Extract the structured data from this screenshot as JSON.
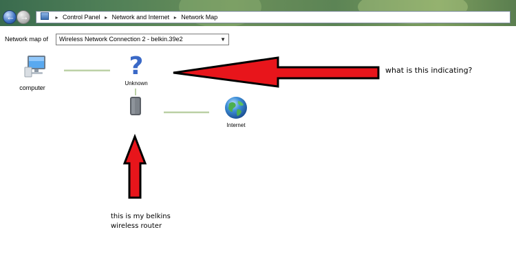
{
  "address_bar": {
    "crumbs": [
      "Control Panel",
      "Network and Internet",
      "Network Map"
    ],
    "back_icon": "back-arrow-icon",
    "forward_icon": "forward-arrow-icon"
  },
  "map_selector": {
    "label": "Network map of",
    "selected": "Wireless Network Connection 2 - belkin.39e2"
  },
  "nodes": {
    "computer": {
      "label": "computer",
      "icon": "computer-icon"
    },
    "unknown": {
      "label": "Unknown",
      "icon": "question-mark-icon"
    },
    "router": {
      "label": "",
      "icon": "router-icon"
    },
    "internet": {
      "label": "Internet",
      "icon": "globe-icon"
    }
  },
  "annotations": {
    "question": "what is this indicating?",
    "router_line1": "this is my belkins",
    "router_line2": "wireless router",
    "arrow_color": "#e8151b"
  }
}
